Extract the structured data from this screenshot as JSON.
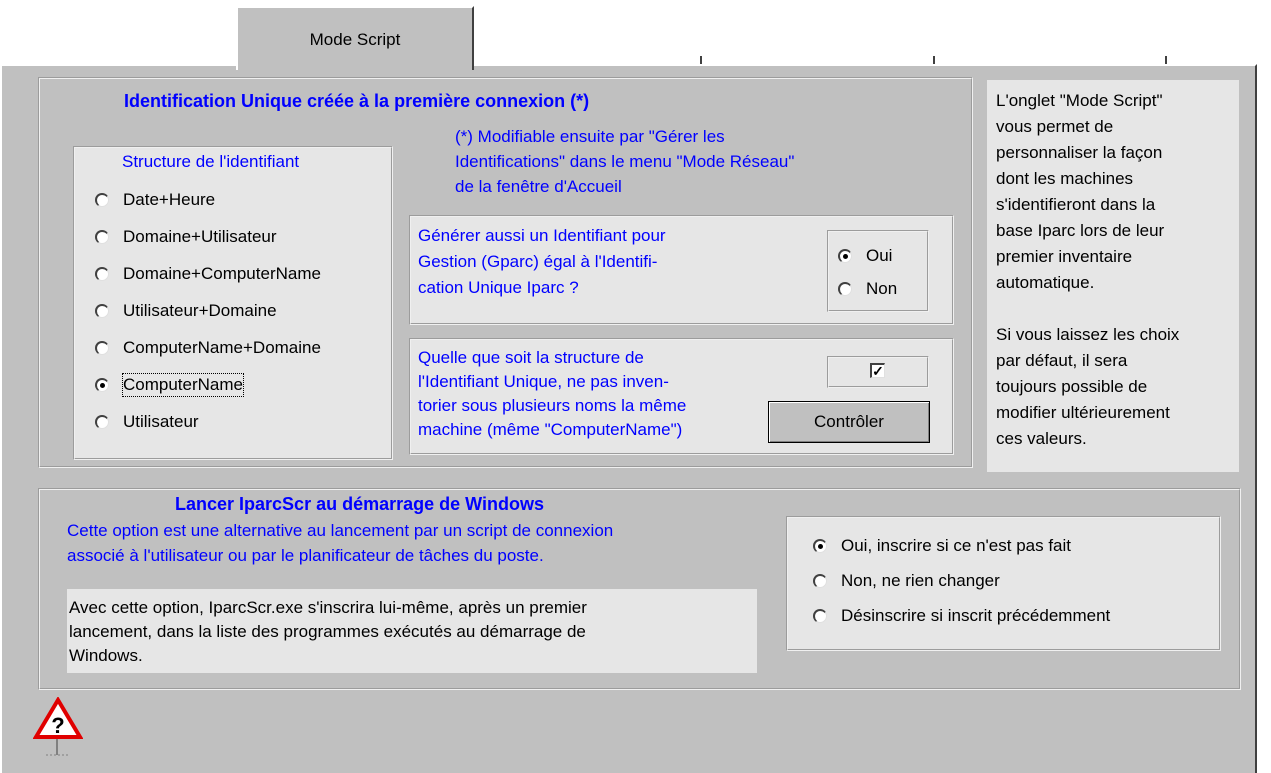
{
  "tabs": {
    "active": "Mode Script"
  },
  "identification": {
    "title": "Identification Unique créée à la première connexion (*)",
    "note": [
      "(*) Modifiable ensuite par \"Gérer les",
      "Identifications\"  dans  le menu \"Mode Réseau\"",
      "de la fenêtre d'Accueil"
    ],
    "structure_title": "Structure de l'identifiant",
    "structure_options": [
      {
        "label": "Date+Heure",
        "checked": false
      },
      {
        "label": "Domaine+Utilisateur",
        "checked": false
      },
      {
        "label": "Domaine+ComputerName",
        "checked": false
      },
      {
        "label": "Utilisateur+Domaine",
        "checked": false
      },
      {
        "label": "ComputerName+Domaine",
        "checked": false
      },
      {
        "label": "ComputerName",
        "checked": true
      },
      {
        "label": "Utilisateur",
        "checked": false
      }
    ],
    "gparc_text": [
      "Générer aussi un Identifiant pour",
      "Gestion (Gparc) égal à l'Identifi-",
      "cation Unique Iparc ?"
    ],
    "gparc_options": [
      {
        "label": "Oui",
        "checked": true
      },
      {
        "label": "Non",
        "checked": false
      }
    ],
    "duplicate_text": [
      "Quelle que soit la structure de",
      "l'Identifiant Unique, ne pas inven-",
      "torier sous plusieurs noms la même",
      "machine (même \"ComputerName\")"
    ],
    "duplicate_checked": true,
    "control_button": "Contrôler"
  },
  "help_text": [
    "L'onglet \"Mode Script\"",
    "vous permet de",
    "personnaliser la façon",
    "dont les machines",
    "s'identifieront dans la",
    "base Iparc lors de leur",
    "premier inventaire",
    "automatique.",
    "",
    "Si vous laissez les choix",
    "par défaut, il sera",
    "toujours possible de",
    "modifier ultérieurement",
    "ces valeurs."
  ],
  "startup": {
    "title": "Lancer IparcScr au démarrage de Windows",
    "subtitle": [
      "Cette option est une alternative au lancement par un script de connexion",
      "associé à l'utilisateur ou par le planificateur de tâches du poste."
    ],
    "info": [
      "Avec cette option, IparcScr.exe s'inscrira lui-même, après un premier",
      "lancement, dans la liste des programmes exécutés au démarrage de",
      "Windows."
    ],
    "options": [
      {
        "label": "Oui, inscrire si ce n'est pas fait",
        "checked": true
      },
      {
        "label": "Non, ne rien changer",
        "checked": false
      },
      {
        "label": "Désinscrire si inscrit précédemment",
        "checked": false
      }
    ]
  },
  "help_icon": "warning-question-icon"
}
